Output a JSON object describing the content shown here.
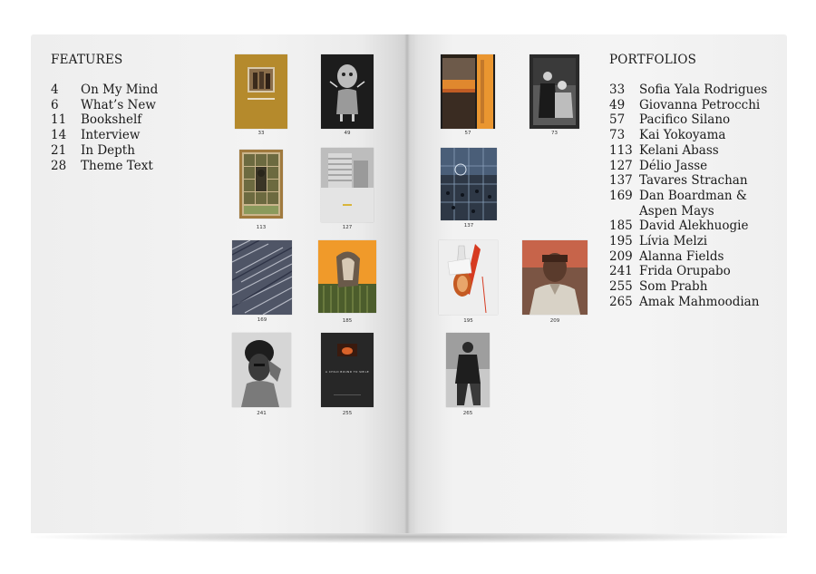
{
  "features": {
    "title": "FEATURES",
    "items": [
      {
        "num": "4",
        "label": "On My Mind"
      },
      {
        "num": "6",
        "label": "What’s New"
      },
      {
        "num": "11",
        "label": "Bookshelf"
      },
      {
        "num": "14",
        "label": "Interview"
      },
      {
        "num": "21",
        "label": "In Depth"
      },
      {
        "num": "28",
        "label": "Theme Text"
      }
    ]
  },
  "portfolios": {
    "title": "PORTFOLIOS",
    "items": [
      {
        "num": "33",
        "label": "Sofia Yala Rodrigues"
      },
      {
        "num": "49",
        "label": "Giovanna Petrocchi"
      },
      {
        "num": "57",
        "label": "Pacifico Silano"
      },
      {
        "num": "73",
        "label": "Kai Yokoyama"
      },
      {
        "num": "113",
        "label": "Kelani Abass"
      },
      {
        "num": "127",
        "label": "Délio Jasse"
      },
      {
        "num": "137",
        "label": "Tavares Strachan"
      },
      {
        "num": "169",
        "label": "Dan Boardman &"
      },
      {
        "num": "",
        "label": "Aspen Mays"
      },
      {
        "num": "185",
        "label": "David Alekhuogie"
      },
      {
        "num": "195",
        "label": "Lívia Melzi"
      },
      {
        "num": "209",
        "label": "Alanna Fields"
      },
      {
        "num": "241",
        "label": "Frida Orupabo"
      },
      {
        "num": "255",
        "label": "Som Prabh"
      },
      {
        "num": "265",
        "label": "Amak Mahmoodian"
      }
    ]
  },
  "thumbnails": [
    {
      "caption": "33",
      "depicts": "sepia-photo-on-gold"
    },
    {
      "caption": "49",
      "depicts": "mask-figure-collage"
    },
    {
      "caption": "113",
      "depicts": "framed-portrait-grid"
    },
    {
      "caption": "127",
      "depicts": "modernist-building"
    },
    {
      "caption": "169",
      "depicts": "abstract-streaks"
    },
    {
      "caption": "185",
      "depicts": "orange-collage-figure"
    },
    {
      "caption": "241",
      "depicts": "bw-portrait-woman"
    },
    {
      "caption": "255",
      "depicts": "dark-book-cover"
    },
    {
      "caption": "57",
      "depicts": "orange-sunset-strips"
    },
    {
      "caption": "73",
      "depicts": "vintage-couple-photo"
    },
    {
      "caption": "137",
      "depicts": "blue-basketball-grid"
    },
    {
      "caption": "195",
      "depicts": "red-drawing-figure"
    },
    {
      "caption": "209",
      "depicts": "painted-portrait-man"
    },
    {
      "caption": "265",
      "depicts": "bw-seated-man"
    }
  ],
  "cover_text_255": "A CHILD BOUND TO SMILE"
}
